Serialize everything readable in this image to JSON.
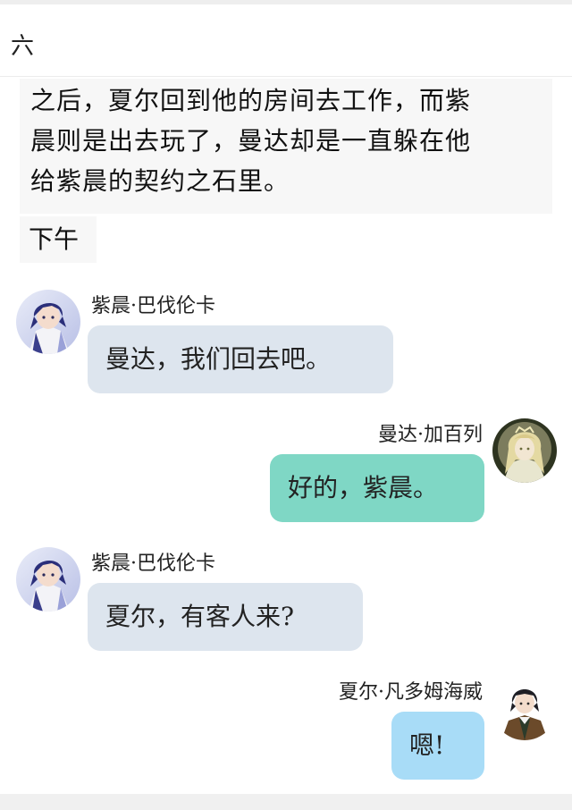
{
  "chapter": {
    "title": "六"
  },
  "narration": {
    "lines": [
      "之后，夏尔回到他的房间去工作，而紫",
      "晨则是出去玩了，曼达却是一直躲在他",
      "给紫晨的契约之石里。"
    ]
  },
  "time_label": "下午",
  "messages": [
    {
      "speaker": "紫晨·巴伐伦卡",
      "text": "曼达，我们回去吧。",
      "side": "left",
      "avatar": "purple-hair-boy-avatar"
    },
    {
      "speaker": "曼达·加百列",
      "text": "好的，紫晨。",
      "side": "right",
      "avatar": "blonde-girl-avatar"
    },
    {
      "speaker": "紫晨·巴伐伦卡",
      "text": "夏尔，有客人来?",
      "side": "left",
      "avatar": "purple-hair-boy-avatar"
    },
    {
      "speaker": "夏尔·凡多姆海威",
      "text": "嗯!",
      "side": "right",
      "avatar": "dark-hair-boy-avatar"
    }
  ],
  "colors": {
    "left_bubble": "#dde5ee",
    "teal_bubble": "#7fd7c5",
    "blue_bubble": "#a8dcf7",
    "narration_bg": "#f7f7f7"
  }
}
